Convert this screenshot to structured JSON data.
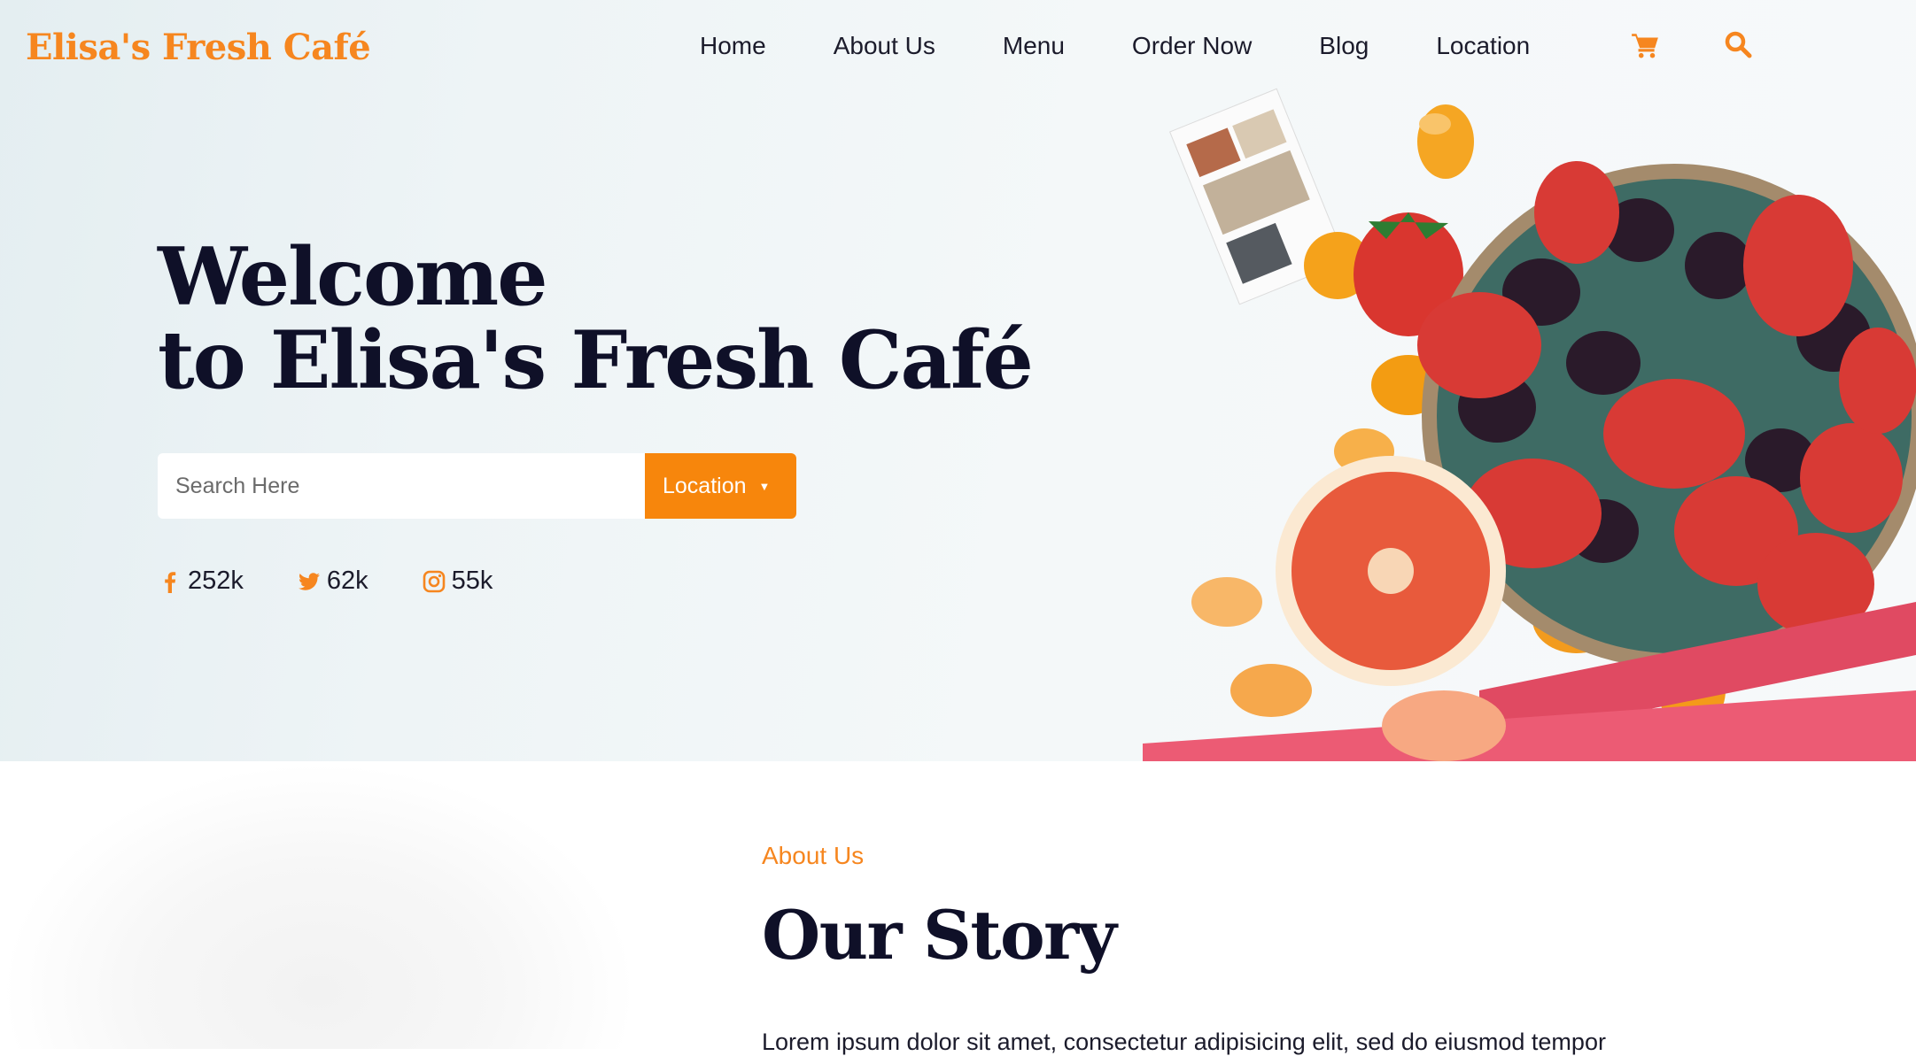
{
  "brand": {
    "name": "Elisa's Fresh Café",
    "accent": "#f6861f",
    "dark": "#0f1028"
  },
  "nav": {
    "items": [
      {
        "label": "Home"
      },
      {
        "label": "About Us"
      },
      {
        "label": "Menu"
      },
      {
        "label": "Order Now"
      },
      {
        "label": "Blog"
      },
      {
        "label": "Location"
      }
    ],
    "icons": [
      "cart-icon",
      "search-icon"
    ]
  },
  "hero": {
    "title_line1": "Welcome",
    "title_line2": "to Elisa's Fresh Café",
    "search": {
      "placeholder": "Search Here",
      "value": ""
    },
    "location_button": "Location"
  },
  "social": [
    {
      "icon": "facebook-icon",
      "count": "252k"
    },
    {
      "icon": "twitter-icon",
      "count": "62k"
    },
    {
      "icon": "instagram-icon",
      "count": "55k"
    }
  ],
  "about": {
    "kicker": "About Us",
    "title": "Our Story",
    "body": "Lorem ipsum dolor sit amet, consectetur adipisicing elit, sed do eiusmod tempor"
  }
}
